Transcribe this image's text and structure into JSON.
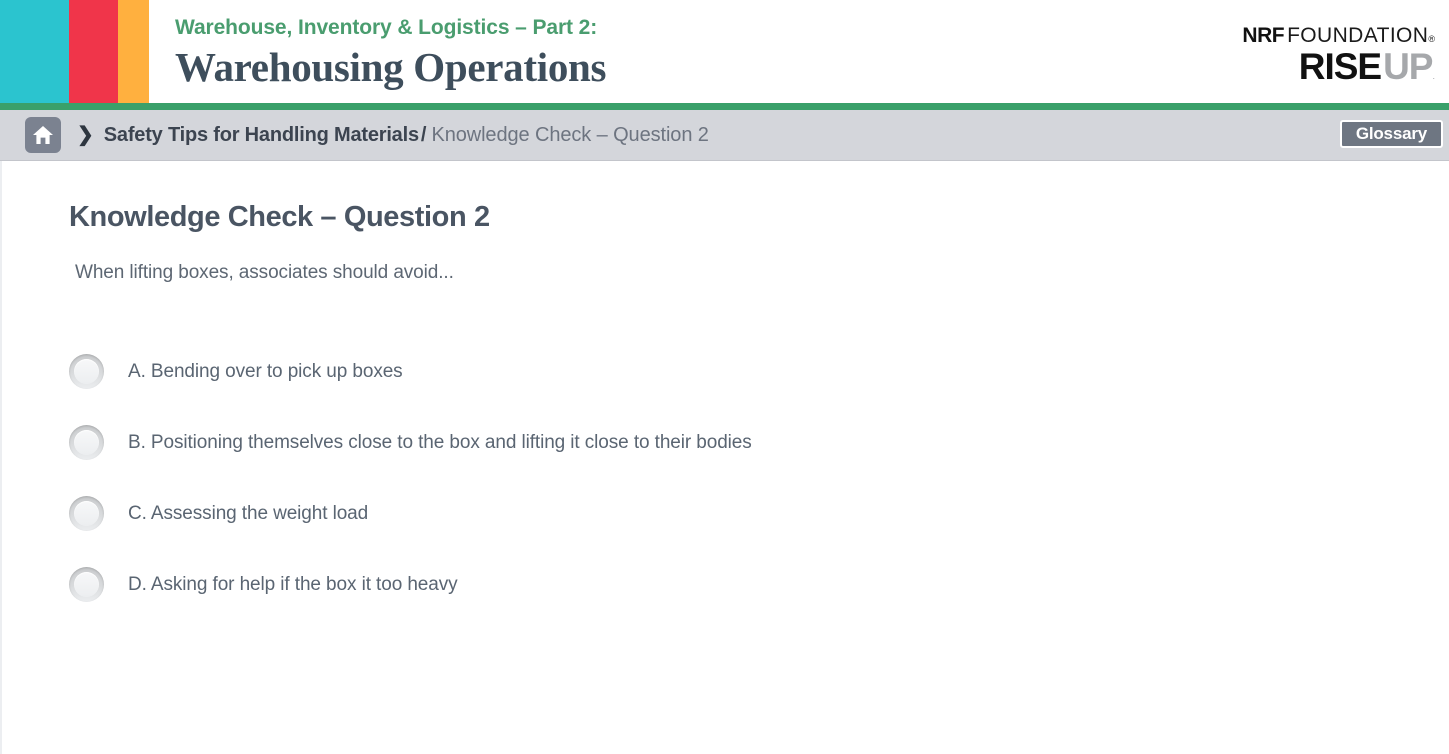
{
  "header": {
    "eyebrow": "Warehouse, Inventory & Logistics – Part 2:",
    "title": "Warehousing Operations",
    "colors": {
      "bar_teal": "#2bc4cf",
      "bar_red": "#f0354a",
      "bar_orange": "#ffb03f",
      "green_rule": "#3aa06a",
      "eyebrow_green": "#4a9d6f",
      "title_slate": "#3e4e5c"
    },
    "logo": {
      "nrf": "NRF",
      "foundation": "FOUNDATION",
      "registered": "®",
      "rise": "RISE",
      "up": "UP",
      "trademark": "."
    }
  },
  "breadcrumb": {
    "home_icon": "home-icon",
    "chevron": "❯",
    "parent": "Safety Tips for Handling Materials",
    "separator": "/",
    "current": "Knowledge Check – Question 2",
    "glossary_label": "Glossary"
  },
  "main": {
    "page_title": "Knowledge Check – Question 2",
    "question": "When lifting boxes, associates should avoid...",
    "options": [
      {
        "id": "A",
        "label": "A. Bending over to pick up boxes",
        "selected": false
      },
      {
        "id": "B",
        "label": "B. Positioning themselves close to the box and lifting it close to their bodies",
        "selected": false
      },
      {
        "id": "C",
        "label": "C. Assessing the weight load",
        "selected": false
      },
      {
        "id": "D",
        "label": "D. Asking for help if the box it too heavy",
        "selected": false
      }
    ]
  }
}
